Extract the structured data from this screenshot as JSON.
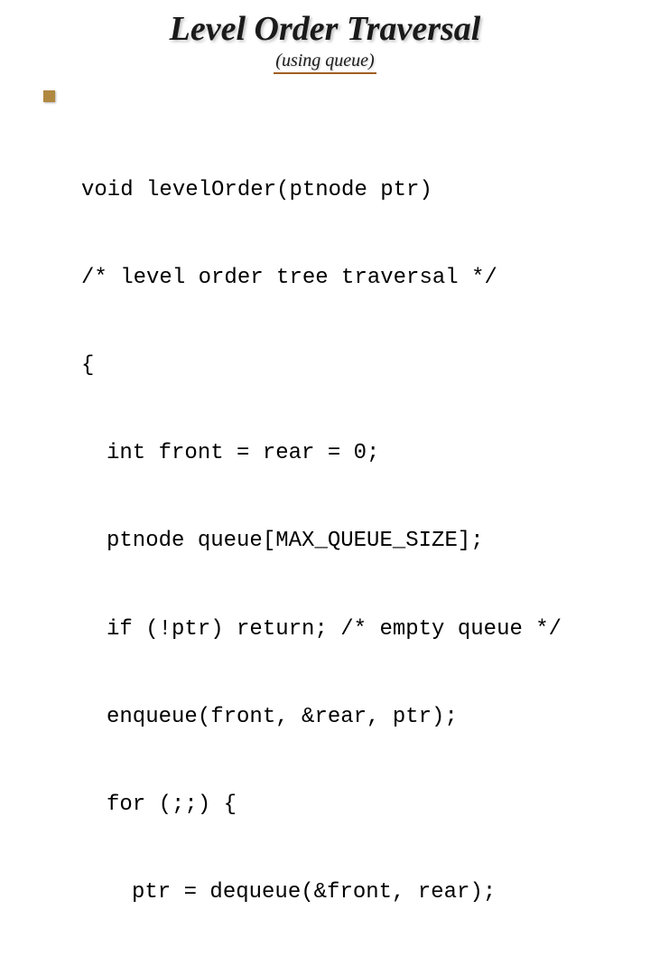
{
  "title": "Level Order Traversal",
  "subtitle": "(using queue)",
  "code": {
    "l1": "void levelOrder(ptnode ptr)",
    "l2": "/* level order tree traversal */",
    "l3": "{",
    "l4": "int front = rear = 0;",
    "l5": "ptnode queue[MAX_QUEUE_SIZE];",
    "l6": "if (!ptr) return; /* empty queue */",
    "l7": "enqueue(front, &rear, ptr);",
    "l8": "for (;;) {",
    "l9": "ptr = dequeue(&front, rear);"
  }
}
